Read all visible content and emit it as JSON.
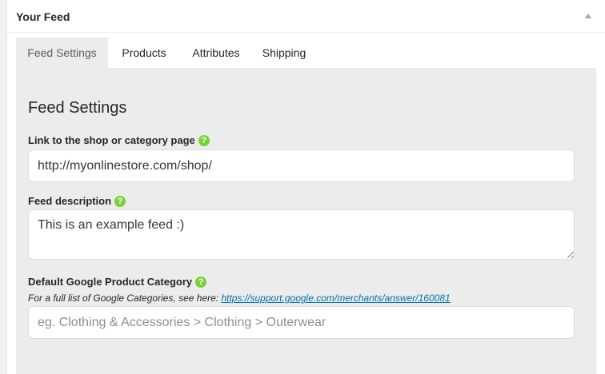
{
  "panel": {
    "title": "Your Feed"
  },
  "tabs": [
    {
      "label": "Feed Settings",
      "active": true
    },
    {
      "label": "Products",
      "active": false
    },
    {
      "label": "Attributes",
      "active": false
    },
    {
      "label": "Shipping",
      "active": false
    }
  ],
  "feed_settings": {
    "section_title": "Feed Settings",
    "link_field": {
      "label": "Link to the shop or category page",
      "value": "http://myonlinestore.com/shop/"
    },
    "description_field": {
      "label": "Feed description",
      "value": "This is an example feed :)"
    },
    "category_field": {
      "label": "Default Google Product Category",
      "hint_prefix": "For a full list of Google Categories, see here:",
      "hint_link": "https://support.google.com/merchants/answer/160081",
      "placeholder": "eg. Clothing & Accessories > Clothing > Outerwear",
      "value": ""
    },
    "help_icon_glyph": "?"
  },
  "colors": {
    "help_icon": "#7ad03a",
    "link": "#0073aa",
    "content_bg": "#ececec"
  }
}
